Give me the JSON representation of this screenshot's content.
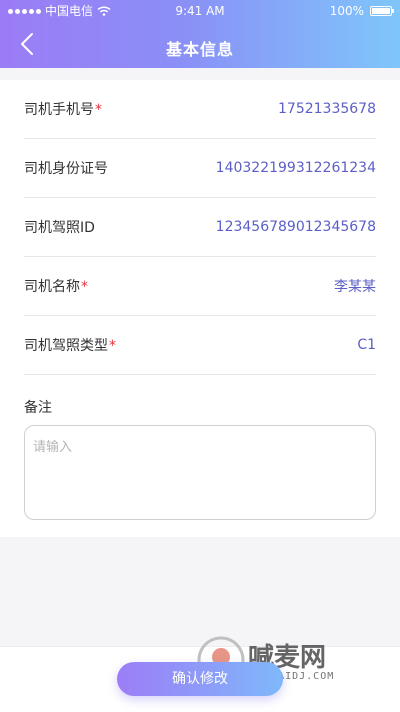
{
  "status_bar": {
    "carrier": "中国电信",
    "time": "9:41 AM",
    "battery": "100%"
  },
  "nav": {
    "title": "基本信息"
  },
  "form": {
    "fields": [
      {
        "label": "司机手机号",
        "required": "*",
        "value": "17521335678"
      },
      {
        "label": "司机身份证号",
        "required": "",
        "value": "140322199312261234"
      },
      {
        "label": "司机驾照ID",
        "required": "",
        "value": "123456789012345678"
      },
      {
        "label": "司机名称",
        "required": "*",
        "value": "李某某"
      },
      {
        "label": "司机驾照类型",
        "required": "*",
        "value": "C1"
      }
    ],
    "remark_label": "备注",
    "remark_placeholder": "请输入"
  },
  "actions": {
    "confirm_label": "确认修改"
  },
  "watermark": {
    "text": "喊麦网",
    "sub": "HANMAIDJ.COM"
  }
}
